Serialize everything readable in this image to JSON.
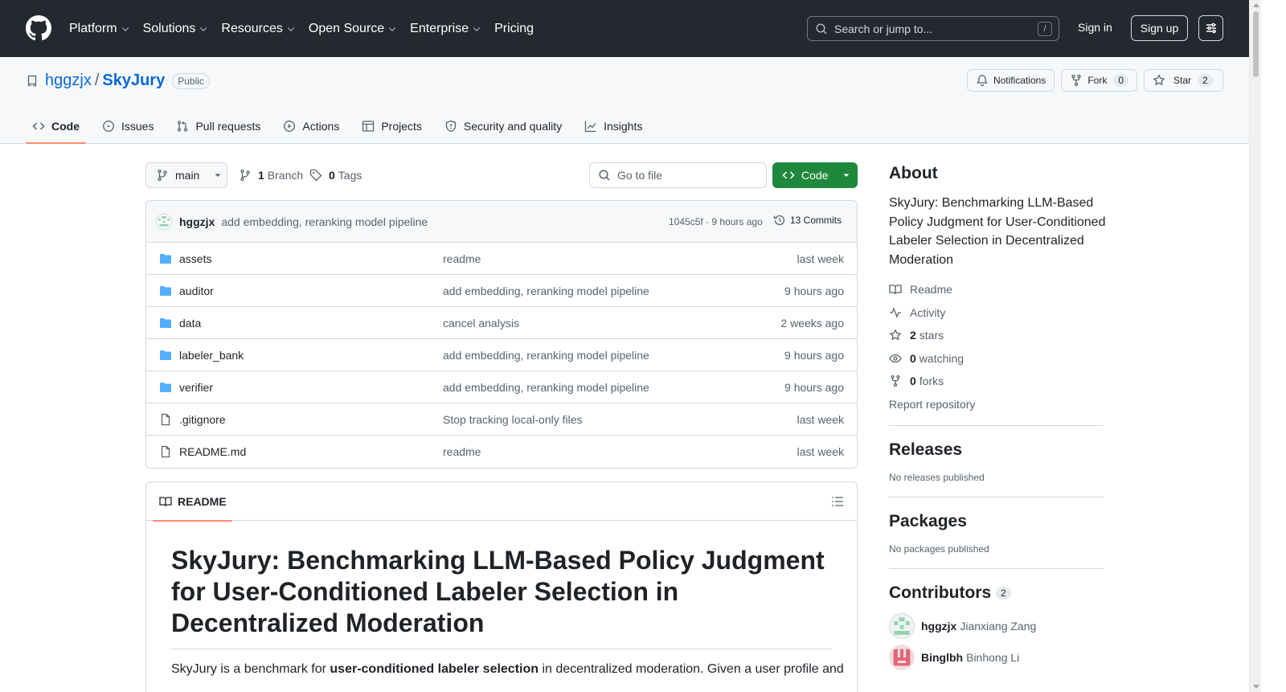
{
  "header": {
    "nav": [
      {
        "label": "Platform",
        "dropdown": true
      },
      {
        "label": "Solutions",
        "dropdown": true
      },
      {
        "label": "Resources",
        "dropdown": true
      },
      {
        "label": "Open Source",
        "dropdown": true
      },
      {
        "label": "Enterprise",
        "dropdown": true
      },
      {
        "label": "Pricing",
        "dropdown": false
      }
    ],
    "search_placeholder": "Search or jump to...",
    "search_shortcut": "/",
    "sign_in": "Sign in",
    "sign_up": "Sign up"
  },
  "repo": {
    "owner": "hggzjx",
    "separator": "/",
    "name": "SkyJury",
    "visibility": "Public",
    "actions": {
      "notifications": "Notifications",
      "fork": "Fork",
      "fork_count": "0",
      "star": "Star",
      "star_count": "2"
    },
    "tabs": [
      {
        "label": "Code",
        "icon": "code-icon",
        "active": true
      },
      {
        "label": "Issues",
        "icon": "issue-icon",
        "active": false
      },
      {
        "label": "Pull requests",
        "icon": "pull-request-icon",
        "active": false
      },
      {
        "label": "Actions",
        "icon": "play-icon",
        "active": false
      },
      {
        "label": "Projects",
        "icon": "table-icon",
        "active": false
      },
      {
        "label": "Security and quality",
        "icon": "shield-icon",
        "active": false
      },
      {
        "label": "Insights",
        "icon": "graph-icon",
        "active": false
      }
    ]
  },
  "toolbar": {
    "branch": "main",
    "branch_count": "1",
    "branch_label": "Branch",
    "tag_count": "0",
    "tag_label": "Tags",
    "goto_placeholder": "Go to file",
    "code_button": "Code"
  },
  "latest_commit": {
    "author": "hggzjx",
    "message": "add embedding, reranking model pipeline",
    "hash_time": "1045c5f · 9 hours ago",
    "commits": "13 Commits"
  },
  "files": [
    {
      "type": "dir",
      "name": "assets",
      "message": "readme",
      "time": "last week"
    },
    {
      "type": "dir",
      "name": "auditor",
      "message": "add embedding, reranking model pipeline",
      "time": "9 hours ago"
    },
    {
      "type": "dir",
      "name": "data",
      "message": "cancel analysis",
      "time": "2 weeks ago"
    },
    {
      "type": "dir",
      "name": "labeler_bank",
      "message": "add embedding, reranking model pipeline",
      "time": "9 hours ago"
    },
    {
      "type": "dir",
      "name": "verifier",
      "message": "add embedding, reranking model pipeline",
      "time": "9 hours ago"
    },
    {
      "type": "file",
      "name": ".gitignore",
      "message": "Stop tracking local-only files",
      "time": "last week"
    },
    {
      "type": "file",
      "name": "README.md",
      "message": "readme",
      "time": "last week"
    }
  ],
  "readme": {
    "tab": "README",
    "heading": "SkyJury: Benchmarking LLM-Based Policy Judgment for User-Conditioned Labeler Selection in Decentralized Moderation",
    "intro_before": "SkyJury is a benchmark for ",
    "intro_bold": "user-conditioned labeler selection",
    "intro_after": " in decentralized moderation. Given a user profile and"
  },
  "sidebar": {
    "about_title": "About",
    "description": "SkyJury: Benchmarking LLM-Based Policy Judgment for User-Conditioned Labeler Selection in Decentralized Moderation",
    "readme": "Readme",
    "activity": "Activity",
    "stars_count": "2",
    "stars_label": "stars",
    "watching_count": "0",
    "watching_label": "watching",
    "forks_count": "0",
    "forks_label": "forks",
    "report": "Report repository",
    "releases_title": "Releases",
    "releases_empty": "No releases published",
    "packages_title": "Packages",
    "packages_empty": "No packages published",
    "contributors_title": "Contributors",
    "contributors_count": "2",
    "contributors": [
      {
        "login": "hggzjx",
        "name": "Jianxiang Zang"
      },
      {
        "login": "Binglbh",
        "name": "Binhong Li"
      }
    ]
  },
  "colors": {
    "header_bg": "#24292f",
    "link": "#0969da",
    "primary_button": "#1f883d",
    "active_tab_underline": "#fd8c73",
    "folder": "#54aeff"
  }
}
